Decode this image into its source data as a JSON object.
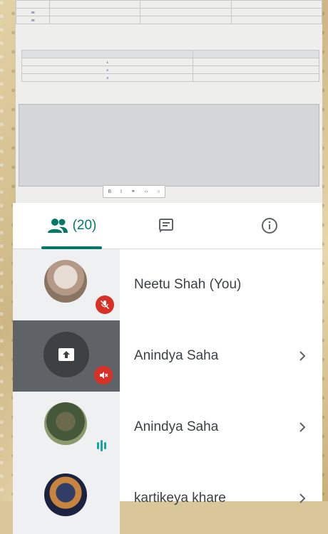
{
  "document": {
    "top_table": [
      [
        "",
        "",
        "",
        ""
      ],
      [
        "38",
        "",
        "",
        ""
      ],
      [
        "39",
        "",
        "",
        ""
      ]
    ],
    "caption1": "",
    "sub_table": {
      "headers": [
        "",
        ""
      ],
      "rows": [
        [
          "1",
          ""
        ],
        [
          "2",
          ""
        ],
        [
          "3",
          ""
        ]
      ]
    },
    "caption2": "",
    "code_lines": [
      "",
      "",
      "",
      "",
      "",
      "",
      "",
      "",
      "",
      "",
      "",
      "",
      ""
    ],
    "caption3": ""
  },
  "tabs": {
    "people_count": "(20)",
    "chat_icon": "chat-icon",
    "info_icon": "info-icon"
  },
  "participants": [
    {
      "name": "Neetu Shah (You)",
      "status": "muted"
    },
    {
      "name": "Anindya Saha",
      "status": "presenting-muted"
    },
    {
      "name": "Anindya Saha",
      "status": "speaking"
    },
    {
      "name": "kartikeya khare",
      "status": "muted"
    }
  ],
  "colors": {
    "accent": "#00796b",
    "muted_badge": "#d93025",
    "speaking": "#1aa5a0"
  }
}
